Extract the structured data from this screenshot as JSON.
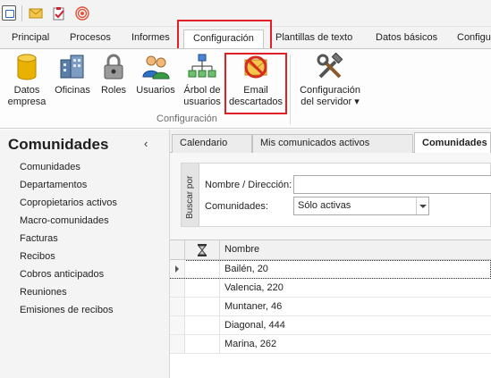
{
  "ribbon_tabs": [
    {
      "label": "Principal"
    },
    {
      "label": "Procesos"
    },
    {
      "label": "Informes"
    },
    {
      "label": "Configuración"
    },
    {
      "label": "Plantillas de texto"
    },
    {
      "label": "Datos básicos"
    },
    {
      "label": "Configu"
    }
  ],
  "active_tab": "Configuración",
  "ribbon": {
    "buttons": [
      {
        "label1": "Datos",
        "label2": "empresa"
      },
      {
        "label1": "Oficinas",
        "label2": ""
      },
      {
        "label1": "Roles",
        "label2": ""
      },
      {
        "label1": "Usuarios",
        "label2": ""
      },
      {
        "label1": "Árbol de",
        "label2": "usuarios"
      },
      {
        "label1": "Email",
        "label2": "descartados"
      },
      {
        "label1": "Configuración",
        "label2": "del servidor ▾"
      }
    ],
    "group_label": "Configuración"
  },
  "left_panel": {
    "title": "Comunidades",
    "collapse": "‹",
    "items": [
      "Comunidades",
      "Departamentos",
      "Copropietarios activos",
      "Macro-comunidades",
      "Facturas",
      "Recibos",
      "Cobros anticipados",
      "Reuniones",
      "Emisiones de recibos"
    ]
  },
  "doc_tabs": [
    {
      "label": "Calendario"
    },
    {
      "label": "Mis comunicados activos"
    },
    {
      "label": "Comunidades"
    }
  ],
  "search": {
    "side_label": "Buscar por",
    "name_label": "Nombre / Dirección:",
    "name_value": "",
    "comm_label": "Comunidades:",
    "comm_value": "Sólo activas"
  },
  "grid": {
    "column_name": "Nombre",
    "rows": [
      "Bailén, 20",
      "Valencia, 220",
      "Muntaner, 46",
      "Diagonal, 444",
      "Marina, 262"
    ]
  },
  "colors": {
    "highlight": "#e01f26",
    "db_gold": "#e9b200",
    "ban_red": "#d82b1f"
  }
}
